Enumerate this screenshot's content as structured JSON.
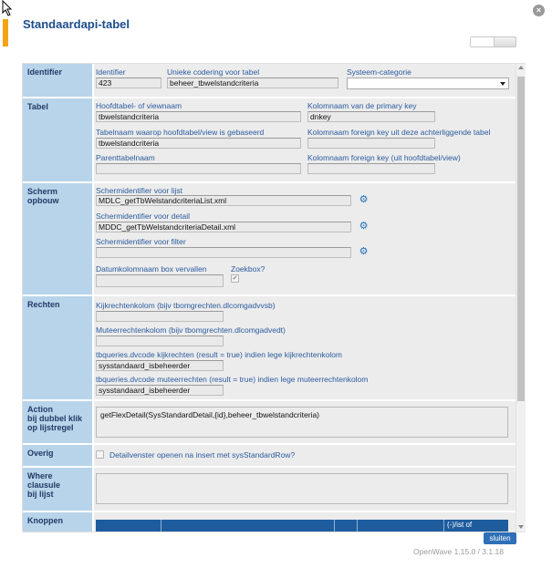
{
  "dialog": {
    "title": "Standaardapi-tabel",
    "close_symbol": "×",
    "version": "OpenWave 1.15.0 / 3.1.18",
    "close_button_label": "sluiten"
  },
  "identifier_section": {
    "label": "Identifier",
    "identifier_label": "Identifier",
    "identifier_value": "423",
    "code_label": "Unieke codering voor tabel",
    "code_value": "beheer_tbwelstandcriteria",
    "category_label": "Systeem-categorie",
    "category_value": ""
  },
  "tabel_section": {
    "label": "Tabel",
    "main_table_label": "Hoofdtabel- of viewnaam",
    "main_table_value": "tbwelstandcriteria",
    "pk_label": "Kolomnaam van de primary key",
    "pk_value": "dnkey",
    "base_table_label": "Tabelnaam waarop hoofdtabel/view is gebaseerd",
    "base_table_value": "tbwelstandcriteria",
    "fk_label": "Kolomnaam foreign key uit deze achterliggende tabel",
    "fk_value": "",
    "parent_label": "Parenttabelnaam",
    "parent_value": "",
    "fk_main_label": "Kolomnaam foreign key (uit hoofdtabel/view)",
    "fk_main_value": ""
  },
  "scherm_section": {
    "label_line1": "Scherm",
    "label_line2": "opbouw",
    "list_label": "Schermidentifier voor lijst",
    "list_value": "MDLC_getTbWelstandcriteriaList.xml",
    "detail_label": "Schermidentifier voor detail",
    "detail_value": "MDDC_getTbWelstandcriteriaDetail.xml",
    "filter_label": "Schermidentifier voor filter",
    "filter_value": "",
    "date_label": "Datumkolomnaam box vervallen",
    "date_value": "",
    "zoekbox_label": "Zoekbox?",
    "zoekbox_checked": true,
    "check_glyph": "✔",
    "gear_glyph": "⚙"
  },
  "rechten_section": {
    "label": "Rechten",
    "kijk_label": "Kijkrechtenkolom (bijv tbomgrechten.dlcomgadvvsb)",
    "kijk_value": "",
    "muteer_label": "Muteerrechtenkolom (bijv tbomgrechten.dlcomgadvedt)",
    "muteer_value": "",
    "dvcode_kijk_label": "tbqueries.dvcode kijkrechten (result = true) indien lege kijkrechtenkolom",
    "dvcode_kijk_value": "sysstandaard_isbeheerder",
    "dvcode_muteer_label": "tbqueries.dvcode muteerrechten (result = true) indien lege muteerrechtenkolom",
    "dvcode_muteer_value": "sysstandaard_isbeheerder"
  },
  "action_section": {
    "label_line1": "Action",
    "label_line2": "bij dubbel klik",
    "label_line3": "op lijstregel",
    "value": "getFlexDetail(SysStandardDetail,{id},beheer_tbwelstandcriteria)"
  },
  "overig_section": {
    "label": "Overig",
    "checkbox_label": "Detailvenster openen na insert met sysStandardRow?"
  },
  "where_section": {
    "label_line1": "Where",
    "label_line2": "clausule",
    "label_line3": "bij lijst",
    "value": ""
  },
  "knoppen_section": {
    "label": "Knoppen",
    "last_column_header": "(-)/ist of"
  }
}
